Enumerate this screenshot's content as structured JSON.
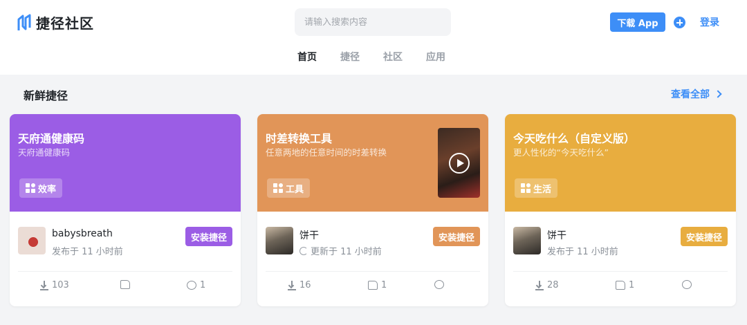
{
  "header": {
    "app_name": "捷径社区",
    "search_placeholder": "请输入搜索内容",
    "download_label": "下载 App",
    "login_label": "登录",
    "nav_tabs": [
      "首页",
      "捷径",
      "社区",
      "应用"
    ],
    "active_tab": "首页"
  },
  "section": {
    "title": "新鲜捷径",
    "view_all_label": "查看全部"
  },
  "cards": [
    {
      "title": "天府通健康码",
      "subtitle": "天府通健康码",
      "tag": "效率",
      "color": "#9b5de5",
      "author": "babysbreath",
      "meta": "发布于 11 小时前",
      "install_label": "安装捷径",
      "downloads": "103",
      "likes": "",
      "comments": "1"
    },
    {
      "title": "时差转换工具",
      "subtitle": "任意两地的任意时间的时差转换",
      "tag": "工具",
      "color": "#e19558",
      "author": "饼干",
      "meta": "更新于 11 小时前",
      "install_label": "安装捷径",
      "downloads": "16",
      "likes": "1",
      "comments": ""
    },
    {
      "title": "今天吃什么（自定义版）",
      "subtitle": "更人性化的“今天吃什么”",
      "tag": "生活",
      "color": "#e8ad3f",
      "author": "饼干",
      "meta": "发布于 11 小时前",
      "install_label": "安装捷径",
      "downloads": "28",
      "likes": "1",
      "comments": ""
    }
  ]
}
